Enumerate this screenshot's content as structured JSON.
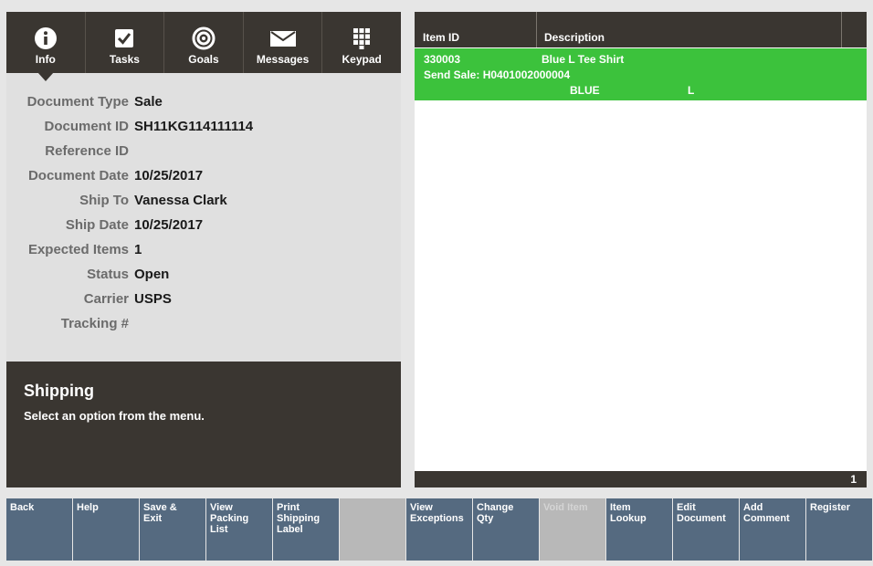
{
  "tabs": [
    {
      "label": "Info",
      "icon": "info-icon"
    },
    {
      "label": "Tasks",
      "icon": "checkbox-icon"
    },
    {
      "label": "Goals",
      "icon": "target-icon"
    },
    {
      "label": "Messages",
      "icon": "envelope-icon"
    },
    {
      "label": "Keypad",
      "icon": "keypad-icon"
    }
  ],
  "fields": [
    {
      "label": "Document Type",
      "value": "Sale"
    },
    {
      "label": "Document ID",
      "value": "SH11KG114111114"
    },
    {
      "label": "Reference ID",
      "value": ""
    },
    {
      "label": "Document Date",
      "value": "10/25/2017"
    },
    {
      "label": "Ship To",
      "value": "Vanessa Clark"
    },
    {
      "label": "Ship Date",
      "value": "10/25/2017"
    },
    {
      "label": "Expected Items",
      "value": "1"
    },
    {
      "label": "Status",
      "value": "Open"
    },
    {
      "label": "Carrier",
      "value": "USPS"
    },
    {
      "label": "Tracking #",
      "value": ""
    }
  ],
  "message": {
    "title": "Shipping",
    "text": "Select an option from the menu."
  },
  "table": {
    "columns": [
      "Item ID",
      "Description"
    ],
    "rows": [
      {
        "item_id": "330003",
        "description": "Blue L Tee Shirt",
        "send_sale": "Send Sale: H0401002000004",
        "color": "BLUE",
        "size": "L"
      }
    ],
    "count": "1"
  },
  "buttons": [
    {
      "label": "Back"
    },
    {
      "label": "Help"
    },
    {
      "label": "Save &\nExit"
    },
    {
      "label": "View\nPacking\nList"
    },
    {
      "label": "Print\nShipping\nLabel"
    },
    {
      "label": ""
    },
    {
      "label": "View\nExceptions"
    },
    {
      "label": "Change\nQty"
    },
    {
      "label": "Void Item"
    },
    {
      "label": "Item\nLookup"
    },
    {
      "label": "Edit\nDocument"
    },
    {
      "label": "Add\nComment"
    },
    {
      "label": "Register"
    }
  ],
  "colors": {
    "dark": "#3a3631",
    "selected_row": "#3cc23c",
    "button": "#556a80",
    "button_disabled": "#b8b8b8"
  }
}
